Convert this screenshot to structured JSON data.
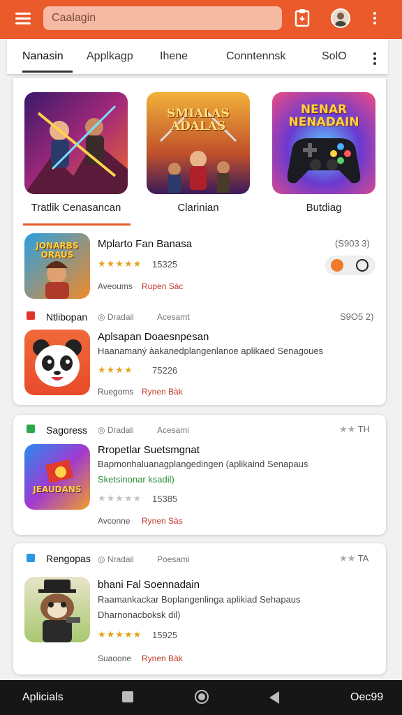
{
  "colors": {
    "accent": "#ea5a2a",
    "star": "#e6a21b",
    "price_red": "#c0392b",
    "green": "#2e8b3a"
  },
  "header": {
    "menu_icon": "hamburger-icon",
    "search_text": "Caalagin",
    "clipboard_icon": "clipboard-icon",
    "avatar_icon": "avatar-icon",
    "more_icon": "more-vertical-icon"
  },
  "tabs": [
    {
      "label": "Nanasin",
      "active": true
    },
    {
      "label": "Applkagp"
    },
    {
      "label": "Ihene"
    },
    {
      "label": "Conntennsk"
    },
    {
      "label": "SolO"
    }
  ],
  "featured": [
    {
      "caption": "Tratlik Cenasancan",
      "art_text": ""
    },
    {
      "caption": "Clarinian",
      "art_text": "SMIALAS ADALAS"
    },
    {
      "caption": "Butdiag",
      "art_text": "NENAR NENADAIN"
    }
  ],
  "apps": [
    {
      "title": "Mplarto Fan Banasa",
      "price": "(S903 3)",
      "stars": "★★★★★",
      "rating_count": "15325",
      "meta_a": "Aveoums",
      "meta_b": "Rupen Sàc",
      "icon_text": "JONARBS ORAUS",
      "pill_icons": [
        "badge-icon",
        "camera-icon"
      ]
    },
    {
      "category": "Ntlibopan",
      "cat_meta_a": "Dradail",
      "cat_meta_b": "Acesamt",
      "price": "S9O5 2)",
      "title": "Aplsapan Doaesnpesan",
      "desc": "Haanamaný àakanedplangenlanoe aplikaed Senagoues",
      "stars": "★★★★",
      "rating_count": "75226",
      "meta_a": "Ruegoms",
      "meta_b": "Rynen Bàk"
    },
    {
      "category": "Sagoress",
      "cat_meta_a": "Dradali",
      "cat_meta_b": "Acesami",
      "price": "TH",
      "title": "Rropetlar Suetsmgnat",
      "desc": "Bapmonhaluanagplangedingen (aplikaind Senapaus",
      "green_text": "Sketsinonar ksadil)",
      "stars": "★★★★★",
      "rating_count": "15385",
      "meta_a": "Avconne",
      "meta_b": "Rynen Sàs",
      "icon_text": "JEAUDANS"
    },
    {
      "category": "Rengopas",
      "cat_meta_a": "Nradail",
      "cat_meta_b": "Poesami",
      "price": "TA",
      "title": "bhani Fal Soennadain",
      "desc": "Raamankackar Boplangenlinga aplikiad Sehapaus",
      "desc2": "Dharnonacboksk dil)",
      "stars": "★★★★★",
      "rating_count": "15925",
      "meta_a": "Suaoone",
      "meta_b": "Rynen Bàk"
    }
  ],
  "navbar": {
    "left": "Aplicials",
    "right": "Oec99"
  }
}
